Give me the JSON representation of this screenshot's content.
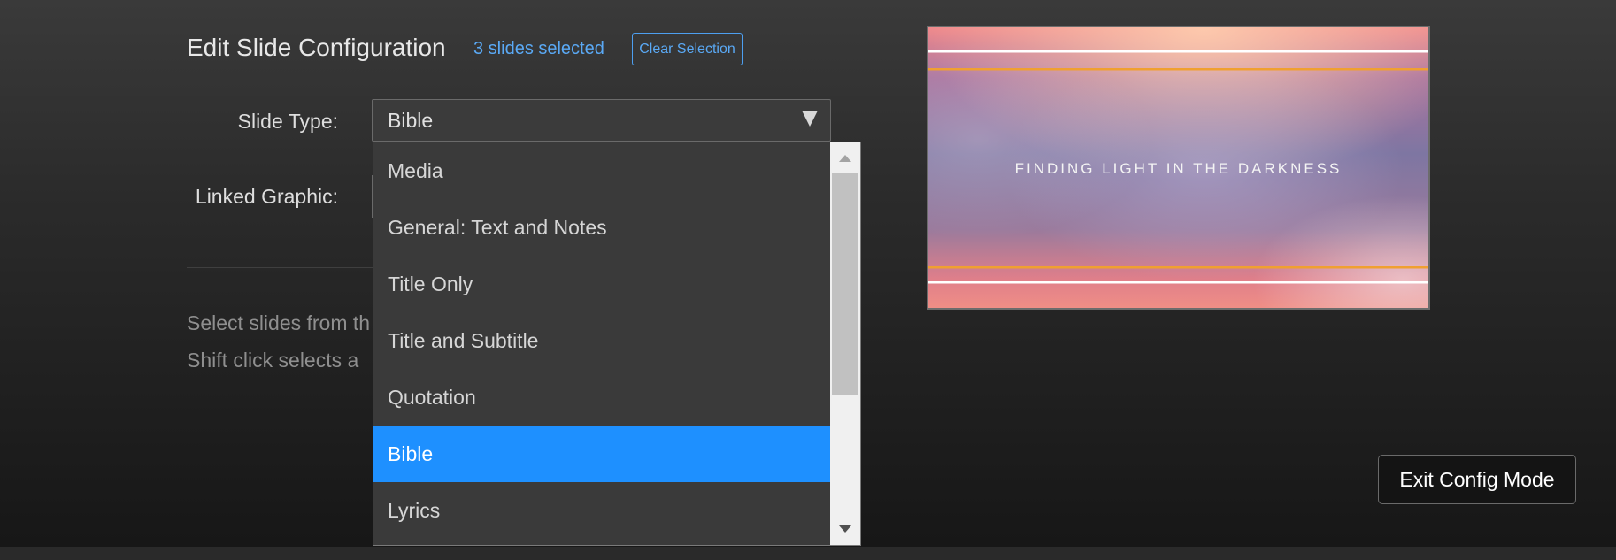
{
  "header": {
    "title": "Edit Slide Configuration",
    "selected_count": "3 slides selected",
    "clear_label": "Clear Selection"
  },
  "form": {
    "slide_type_label": "Slide Type:",
    "slide_type_value": "Bible",
    "linked_graphic_label": "Linked Graphic:"
  },
  "dropdown": {
    "options": [
      {
        "label": "Media",
        "selected": false
      },
      {
        "label": "General: Text and Notes",
        "selected": false
      },
      {
        "label": "Title Only",
        "selected": false
      },
      {
        "label": "Title and Subtitle",
        "selected": false
      },
      {
        "label": "Quotation",
        "selected": false
      },
      {
        "label": "Bible",
        "selected": true
      },
      {
        "label": "Lyrics",
        "selected": false
      }
    ]
  },
  "help": {
    "line1": "Select slides from th",
    "line2": "Shift click selects a"
  },
  "preview": {
    "title": "FINDING LIGHT IN THE DARKNESS"
  },
  "footer": {
    "exit_label": "Exit Config Mode"
  },
  "colors": {
    "accent": "#1e90ff",
    "link": "#5aa9f5",
    "preview_rule_gold": "#f0a030"
  }
}
